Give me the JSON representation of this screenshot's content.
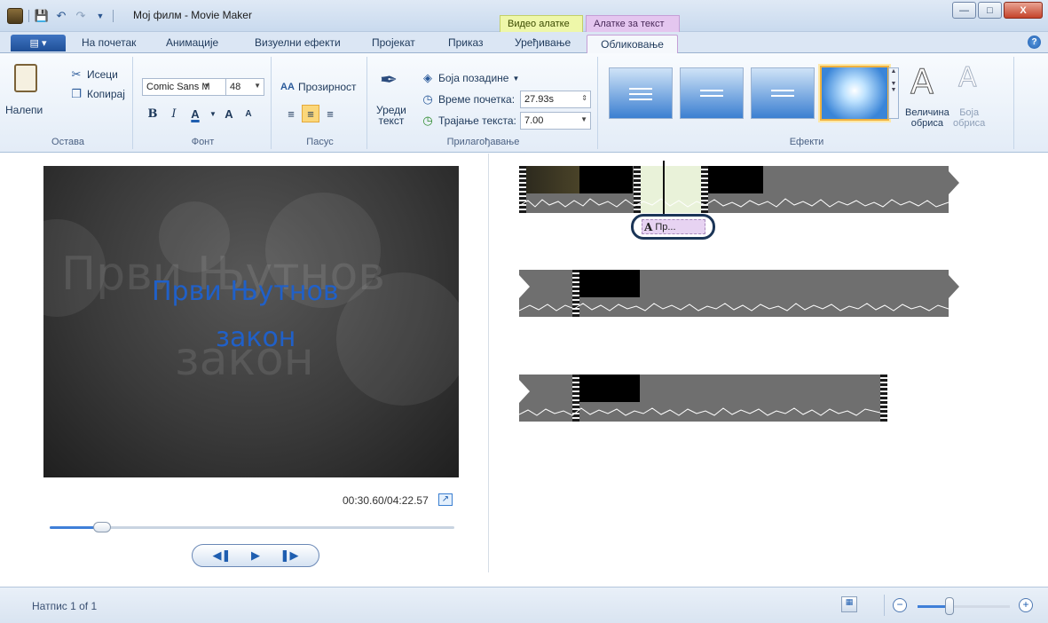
{
  "window": {
    "title": "Мој филм - Movie Maker",
    "contextual_tabs": {
      "video_tools": "Видео алатке",
      "text_tools": "Алатке за текст"
    }
  },
  "tabs": {
    "file_label": "",
    "items": [
      "На почетак",
      "Анимације",
      "Визуелни ефекти",
      "Пројекат",
      "Приказ",
      "Уређивање"
    ],
    "active": "Обликовање"
  },
  "ribbon": {
    "clipboard": {
      "paste": "Налепи",
      "cut": "Исеци",
      "copy": "Копирај",
      "label": "Остава"
    },
    "font": {
      "family": "Comic Sans M",
      "size": "48",
      "bold": "B",
      "italic": "I",
      "color": "A",
      "grow": "A",
      "shrink": "A",
      "label": "Фонт"
    },
    "paragraph": {
      "transparency": "Прозирност",
      "label": "Пасус"
    },
    "adjust": {
      "edit_text_line1": "Уреди",
      "edit_text_line2": "текст",
      "background_color": "Боја позадине",
      "start_time_label": "Време почетка:",
      "start_time_value": "27.93s",
      "duration_label": "Трајање текста:",
      "duration_value": "7.00",
      "label": "Прилагођавање"
    },
    "effects": {
      "label": "Ефекти",
      "outline_size_line1": "Величина",
      "outline_size_line2": "обриса",
      "outline_color_line1": "Боја",
      "outline_color_line2": "обриса"
    }
  },
  "preview": {
    "caption_line1": "Први Њутнов",
    "caption_line2": "закон",
    "time": "00:30.60/04:22.57",
    "seek_fraction": 0.13
  },
  "timeline": {
    "caption_chip": "Пр..."
  },
  "status": {
    "caption_count": "Натпис 1 of 1",
    "zoom_fraction": 0.35
  },
  "icons": [
    "app-icon",
    "save-icon",
    "undo-icon",
    "redo-icon",
    "help-icon",
    "paste-icon",
    "cut-icon",
    "copy-icon",
    "edit-text-icon",
    "background-color-icon",
    "start-time-icon",
    "duration-icon",
    "expand-icon",
    "storyboard-icon",
    "zoom-out-icon",
    "zoom-in-icon"
  ]
}
